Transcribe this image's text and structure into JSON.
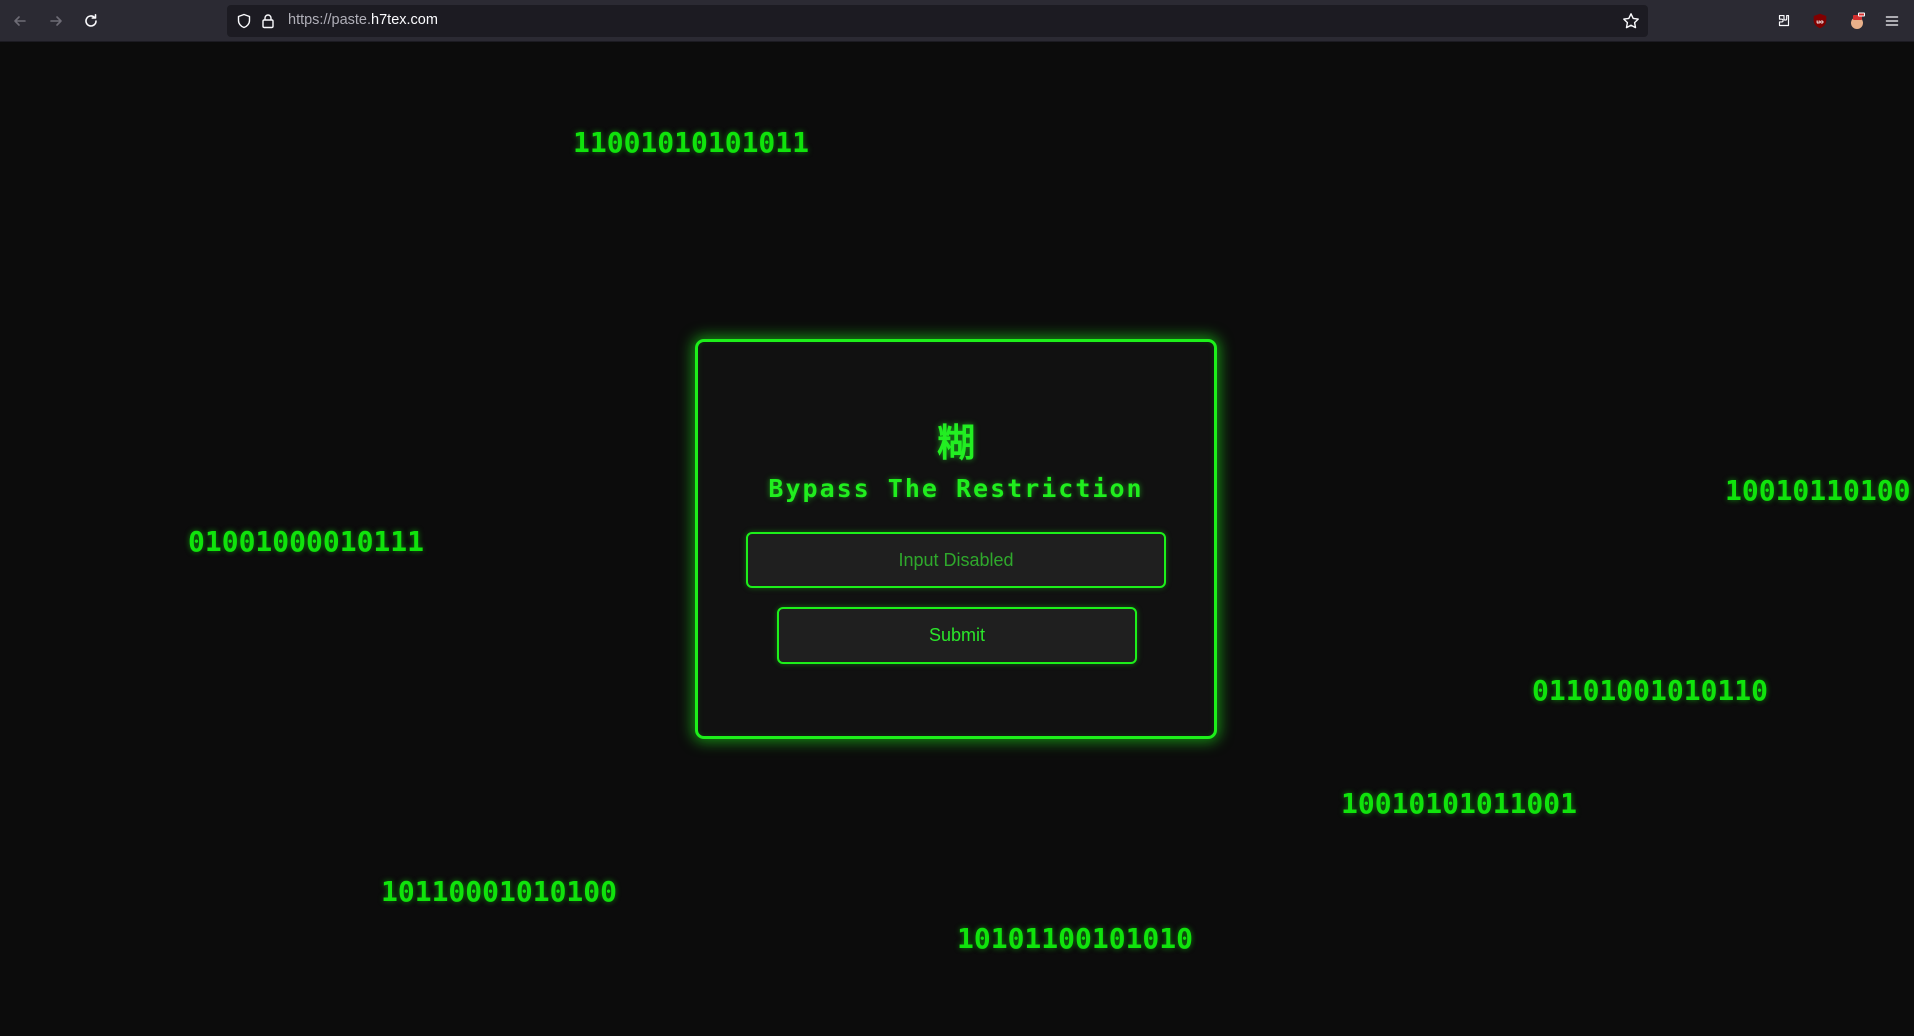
{
  "browser": {
    "url_prefix": "https://paste.",
    "url_domain": "h7tex.com",
    "icons": {
      "back": "arrow-left-icon",
      "forward": "arrow-right-icon",
      "reload": "reload-icon",
      "shield": "tracking-protection-shield-icon",
      "lock": "lock-icon",
      "bookmark": "star-icon",
      "extensions": [
        "extension-icon",
        "ublock-origin-icon",
        "extension-avatar-icon",
        "menu-icon"
      ]
    }
  },
  "background_binary": [
    "11001010101011",
    "01001000010111",
    "10010110100",
    "01101001010110",
    "10010101011001",
    "10110001010100",
    "10101100101010"
  ],
  "card": {
    "glyph": "糊",
    "title": "Bypass The Restriction",
    "input_placeholder": "Input Disabled",
    "submit_label": "Submit"
  },
  "colors": {
    "accent_green": "#1df01a",
    "binary_green": "#10e30c",
    "page_background": "#0c0c0c",
    "chrome_background": "#2b2a33"
  }
}
